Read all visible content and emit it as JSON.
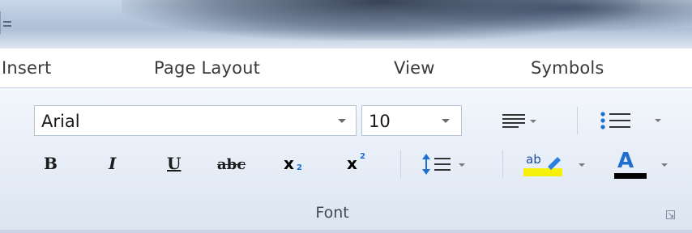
{
  "quick_access": {
    "customize_icon": "customize-qat-icon"
  },
  "tabs": [
    {
      "label": "Insert"
    },
    {
      "label": "Page Layout"
    },
    {
      "label": "View"
    },
    {
      "label": "Symbols"
    }
  ],
  "font_group": {
    "font_name": "Arial",
    "font_size": "10",
    "label": "Font",
    "buttons": {
      "bold": "B",
      "italic": "I",
      "underline": "U",
      "strikethrough": "abc",
      "subscript": "x",
      "subscript_mark": "2",
      "superscript": "x",
      "superscript_mark": "2",
      "highlight_text": "ab",
      "font_color": "A"
    }
  },
  "colors": {
    "highlight": "#f5f00a",
    "font_color": "#000000",
    "accent": "#1f6fd0"
  }
}
